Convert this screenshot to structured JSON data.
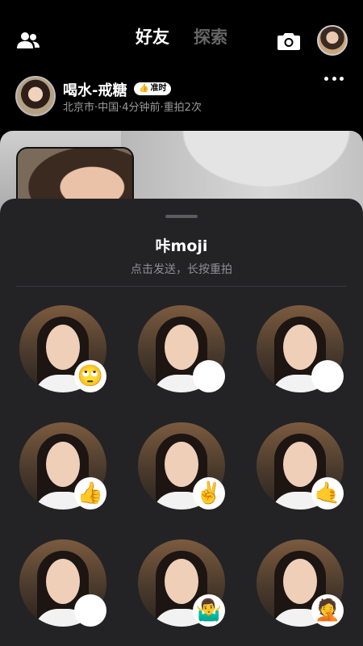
{
  "header": {
    "tab_friends": "好友",
    "tab_explore": "探索"
  },
  "post": {
    "name": "喝水-戒糖",
    "badge": "准时",
    "meta": "北京市·中国·4分钟前·重拍2次"
  },
  "sheet": {
    "title": "咔moji",
    "subtitle": "点击发送，长按重拍"
  },
  "reactions": [
    {
      "emoji": "🙄",
      "icon": "face-rolling-eyes-icon"
    },
    {
      "emoji": "😝",
      "icon": "squinting-tongue-icon"
    },
    {
      "emoji": "😄",
      "icon": "grinning-face-icon"
    },
    {
      "emoji": "👍",
      "icon": "thumbs-up-icon"
    },
    {
      "emoji": "✌️",
      "icon": "victory-hand-icon"
    },
    {
      "emoji": "🤙",
      "icon": "call-me-hand-icon"
    },
    {
      "emoji": "😱",
      "icon": "screaming-face-icon"
    },
    {
      "emoji": "🤷‍♂️",
      "icon": "shrug-icon"
    },
    {
      "emoji": "🤦",
      "icon": "facepalm-icon"
    }
  ]
}
